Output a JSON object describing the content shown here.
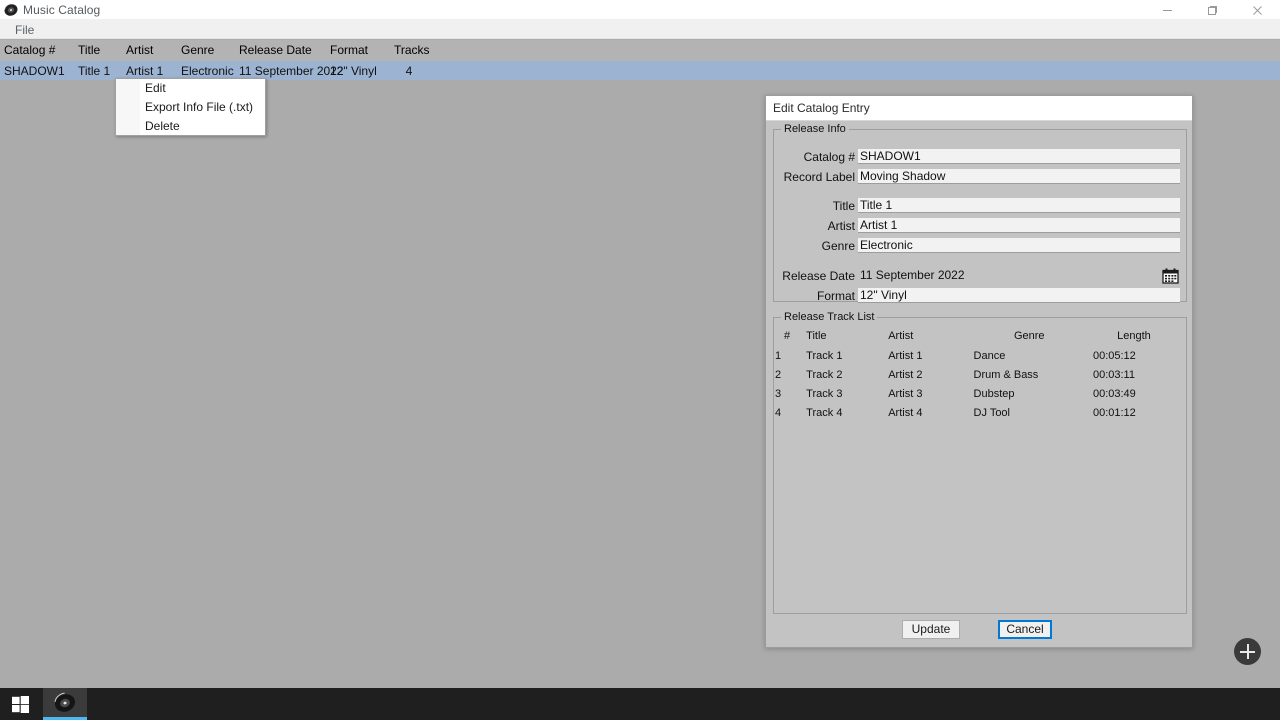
{
  "window": {
    "title": "Music Catalog",
    "icon": "vinyl-record-icon",
    "controls": {
      "minimize": "minimize-icon",
      "maximize": "maximize-icon",
      "close": "close-icon"
    }
  },
  "menubar": {
    "items": [
      "File"
    ]
  },
  "grid": {
    "columns": [
      "Catalog #",
      "Title",
      "Artist",
      "Genre",
      "Release Date",
      "Format",
      "Tracks"
    ],
    "rows": [
      {
        "catalog": "SHADOW1",
        "title": "Title 1",
        "artist": "Artist 1",
        "genre": "Electronic",
        "release_date": "11 September 2022",
        "format": "12\" Vinyl",
        "tracks": "4",
        "selected": true
      }
    ],
    "selected_row_color": "#9cb4d2",
    "header_color": "#b3b3b3"
  },
  "context_menu": {
    "items": [
      {
        "label": "Edit"
      },
      {
        "label": "Export Info File (.txt)"
      },
      {
        "label": "Delete"
      }
    ]
  },
  "dialog": {
    "title": "Edit Catalog Entry",
    "release_info": {
      "legend": "Release Info",
      "fields": {
        "catalog_label": "Catalog #",
        "catalog_value": "SHADOW1",
        "record_label_label": "Record Label",
        "record_label_value": "Moving Shadow",
        "title_label": "Title",
        "title_value": "Title 1",
        "artist_label": "Artist",
        "artist_value": "Artist 1",
        "genre_label": "Genre",
        "genre_value": "Electronic",
        "release_date_label": "Release Date",
        "release_date_value": "11 September 2022",
        "format_label": "Format",
        "format_value": "12\" Vinyl"
      },
      "calendar_icon": "calendar-icon"
    },
    "track_list": {
      "legend": "Release Track List",
      "columns": [
        "#",
        "Title",
        "Artist",
        "Genre",
        "Length"
      ],
      "rows": [
        {
          "num": "1",
          "title": "Track 1",
          "artist": "Artist 1",
          "genre": "Dance",
          "length": "00:05:12"
        },
        {
          "num": "2",
          "title": "Track 2",
          "artist": "Artist 2",
          "genre": "Drum & Bass",
          "length": "00:03:11"
        },
        {
          "num": "3",
          "title": "Track 3",
          "artist": "Artist 3",
          "genre": "Dubstep",
          "length": "00:03:49"
        },
        {
          "num": "4",
          "title": "Track 4",
          "artist": "Artist 4",
          "genre": "DJ Tool",
          "length": "00:01:12"
        }
      ]
    },
    "buttons": {
      "update": "Update",
      "cancel": "Cancel",
      "focus_color": "#0078d7"
    }
  },
  "fab": {
    "icon": "plus-icon"
  },
  "taskbar": {
    "start": "windows-start-icon",
    "items": [
      {
        "name": "Music Catalog",
        "icon": "vinyl-record-icon",
        "active": true
      }
    ],
    "accent_color": "#4cb8ef"
  },
  "colors": {
    "app_background": "#ababab",
    "dialog_background": "#c3c3c3",
    "menubar": "#f0f0f0",
    "input_background": "#f2f2f2",
    "taskbar": "#1f1f1f"
  }
}
